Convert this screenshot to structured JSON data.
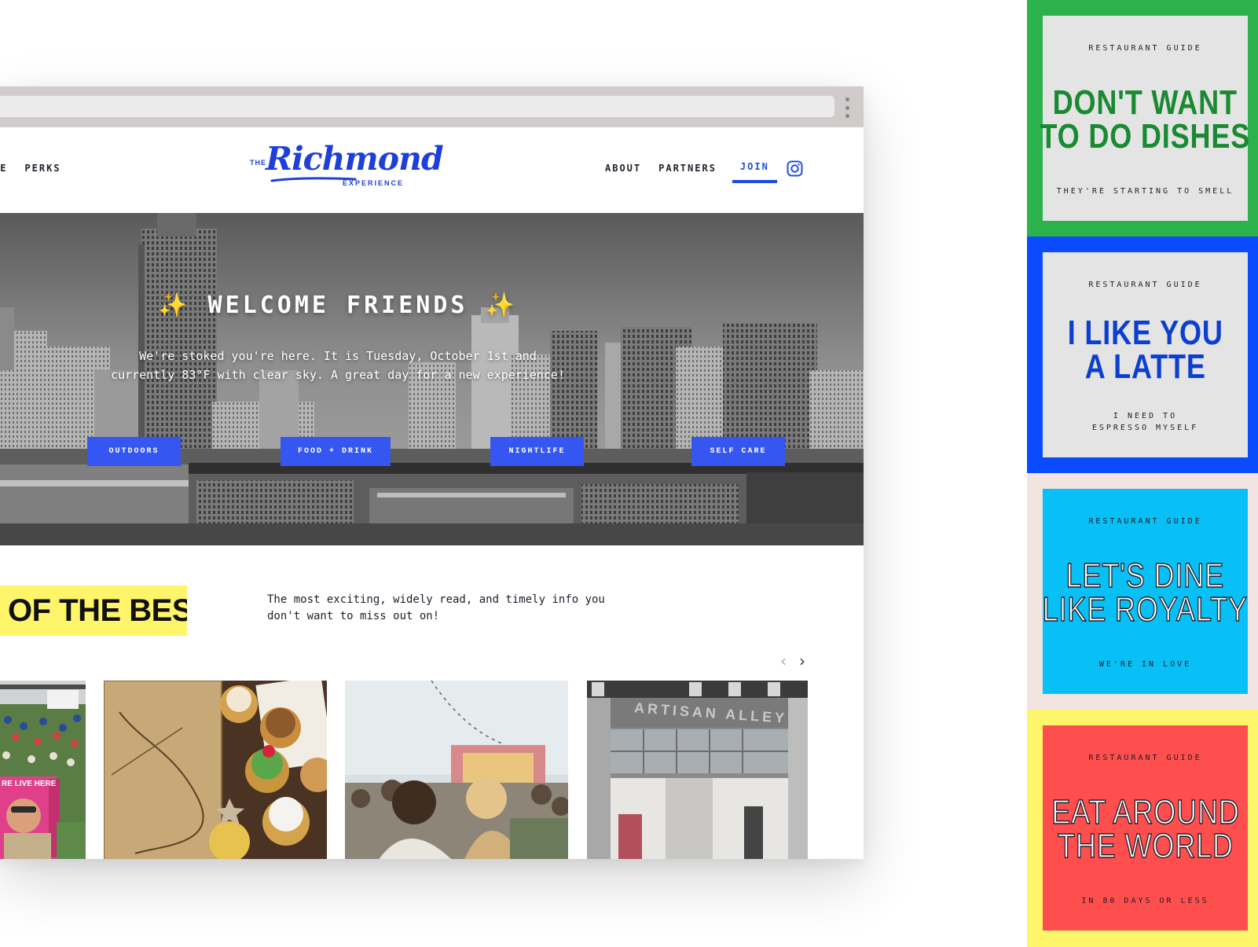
{
  "site": {
    "logo": {
      "the": "THE",
      "name": "Richmond",
      "sub": "EXPERIENCE"
    },
    "nav_left": [
      "RE",
      "PERKS"
    ],
    "nav_right": [
      "ABOUT",
      "PARTNERS",
      "JOIN"
    ],
    "active_nav": "JOIN",
    "icon": "instagram-icon"
  },
  "hero": {
    "sparkle": "✨",
    "title": "WELCOME FRIENDS",
    "text": "We're stoked you're here. It is Tuesday, October 1st and currently 83°F with clear sky. A great day for a new experience!",
    "buttons": [
      "OUTDOORS",
      "FOOD + DRINK",
      "NIGHTLIFE",
      "SELF CARE"
    ]
  },
  "best": {
    "badge": "OF THE BEST",
    "description": "The most exciting, widely read, and timely info you don't want to miss out on!",
    "prev_icon": "‹",
    "next_icon": "›",
    "card_labels": [
      "RE LIVE HERE",
      "ARTISAN ALLEY"
    ]
  },
  "tiles": [
    {
      "kicker": "RESTAURANT GUIDE",
      "title": [
        "DON'T WANT",
        "TO DO DISHES"
      ],
      "sub": [
        "THEY'RE STARTING TO SMELL"
      ]
    },
    {
      "kicker": "RESTAURANT GUIDE",
      "title": [
        "I LIKE YOU",
        "A LATTE"
      ],
      "sub": [
        "I NEED TO",
        "ESPRESSO MYSELF"
      ]
    },
    {
      "kicker": "RESTAURANT GUIDE",
      "title": [
        "LET'S DINE",
        "LIKE ROYALTY"
      ],
      "sub": [
        "WE'RE IN LOVE"
      ]
    },
    {
      "kicker": "RESTAURANT GUIDE",
      "title": [
        "EAT AROUND",
        "THE WORLD"
      ],
      "sub": [
        "IN 80 DAYS OR LESS"
      ]
    }
  ],
  "colors": {
    "brand_blue": "#1f3fd9",
    "button_blue": "#3556f0",
    "highlight_yellow": "#fff56b",
    "tile1_border": "#2bb24c",
    "tile1_text": "#1a8a32",
    "tile2_border": "#0b4bff",
    "tile2_text": "#0b3fd0",
    "tile3_border": "#f1e3df",
    "tile3_inner": "#08c0f5",
    "tile4_border": "#fdf56a",
    "tile4_inner": "#ff4e4e"
  }
}
